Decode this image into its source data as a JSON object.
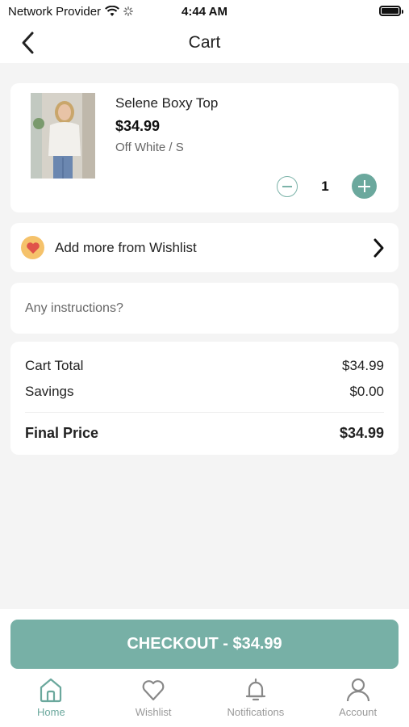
{
  "status_bar": {
    "carrier": "Network Provider",
    "time": "4:44 AM"
  },
  "header": {
    "title": "Cart"
  },
  "cart_item": {
    "name": "Selene Boxy Top",
    "price": "$34.99",
    "variant": "Off White / S",
    "quantity": "1"
  },
  "wishlist": {
    "label": "Add more from Wishlist"
  },
  "instructions": {
    "placeholder": "Any instructions?"
  },
  "summary": {
    "cart_total_label": "Cart Total",
    "cart_total_value": "$34.99",
    "savings_label": "Savings",
    "savings_value": "$0.00",
    "final_price_label": "Final Price",
    "final_price_value": "$34.99"
  },
  "checkout": {
    "label": "CHECKOUT - $34.99"
  },
  "tabs": [
    {
      "label": "Home",
      "icon": "home-icon",
      "active": true
    },
    {
      "label": "Wishlist",
      "icon": "heart-icon",
      "active": false
    },
    {
      "label": "Notifications",
      "icon": "bell-icon",
      "active": false
    },
    {
      "label": "Account",
      "icon": "user-icon",
      "active": false
    }
  ],
  "colors": {
    "accent": "#6ba89d",
    "checkout_button": "#77b0a6",
    "background": "#f4f4f4"
  }
}
